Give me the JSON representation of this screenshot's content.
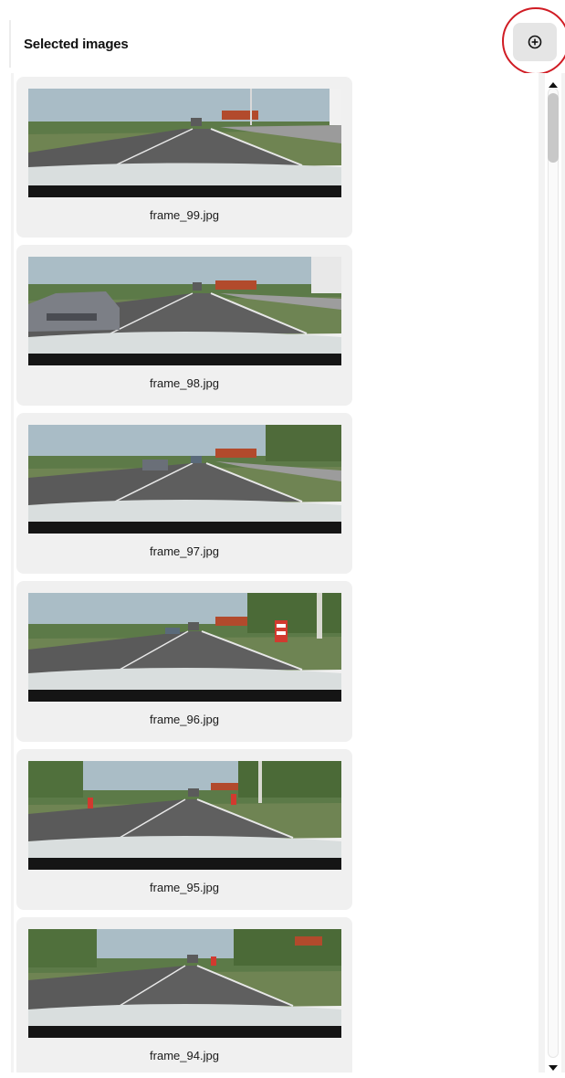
{
  "header": {
    "title": "Selected images",
    "add_button_icon": "add-circle-icon"
  },
  "images": [
    {
      "filename": "frame_99.jpg"
    },
    {
      "filename": "frame_98.jpg"
    },
    {
      "filename": "frame_97.jpg"
    },
    {
      "filename": "frame_96.jpg"
    },
    {
      "filename": "frame_95.jpg"
    },
    {
      "filename": "frame_94.jpg"
    }
  ],
  "colors": {
    "highlight_ring": "#d01c24",
    "card_background": "#f0f0f0",
    "add_button_background": "#e5e5e5"
  }
}
